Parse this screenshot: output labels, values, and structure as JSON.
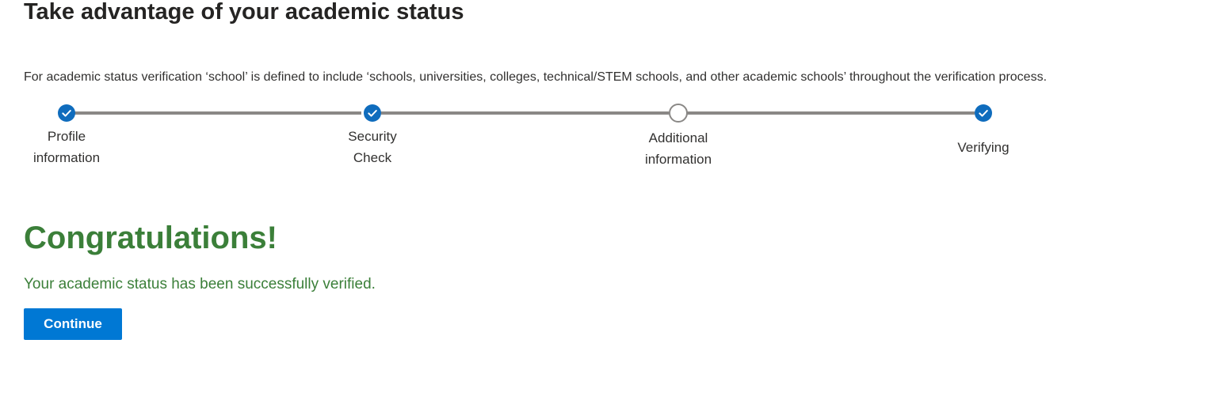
{
  "header": {
    "title": "Take advantage of your academic status"
  },
  "definition": {
    "text": "For academic status verification ‘school’ is defined to include ‘schools, universities, colleges, technical/STEM schools, and other academic schools’ throughout the verification process."
  },
  "stepper": {
    "steps": [
      {
        "line1": "Profile",
        "line2": "information",
        "status": "complete",
        "icon": "checkmark-icon"
      },
      {
        "line1": "Security",
        "line2": "Check",
        "status": "complete",
        "icon": "checkmark-icon"
      },
      {
        "line1": "Additional",
        "line2": "information",
        "status": "incomplete",
        "icon": "empty-circle-icon"
      },
      {
        "line1": "Verifying",
        "line2": "",
        "status": "complete",
        "icon": "checkmark-icon"
      }
    ]
  },
  "result": {
    "heading": "Congratulations!",
    "message": "Your academic status has been successfully verified."
  },
  "actions": {
    "continue_label": "Continue"
  },
  "colors": {
    "primary_button": "#0078d4",
    "step_complete": "#0f6cbd",
    "step_line": "#8a8886",
    "success_text": "#3b7f39"
  }
}
